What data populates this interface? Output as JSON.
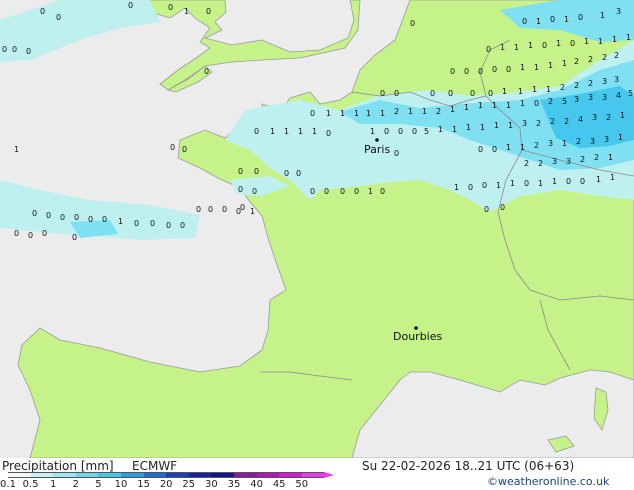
{
  "map": {
    "cities": [
      {
        "name": "Paris"
      },
      {
        "name": "Dourbies"
      }
    ],
    "colors": {
      "sea": "#ececec",
      "land": "#c6f28a",
      "precip_light": "#bff0f0",
      "precip_mid": "#7fe0f2",
      "precip_heavy": "#46c8ee",
      "border": "#8a8a8a",
      "coast": "#9a9a9a"
    }
  },
  "footer": {
    "title": "Precipitation [mm]",
    "model": "ECMWF",
    "datetime": "Su 22-02-2026 18..21 UTC (06+63)",
    "credit": "©weatheronline.co.uk",
    "scale_ticks": [
      "0.1",
      "0.5",
      "1",
      "2",
      "5",
      "10",
      "15",
      "20",
      "25",
      "30",
      "35",
      "40",
      "45",
      "50"
    ],
    "scale_colors": [
      "#f0fafa",
      "#c8f2f6",
      "#9ee6f2",
      "#6fd6ee",
      "#46c4ea",
      "#2c9ee0",
      "#1c6fd0",
      "#1a3fbe",
      "#1822a8",
      "#14128a",
      "#8a1aa0",
      "#b414b4",
      "#d41ad4",
      "#e83ae8"
    ]
  }
}
